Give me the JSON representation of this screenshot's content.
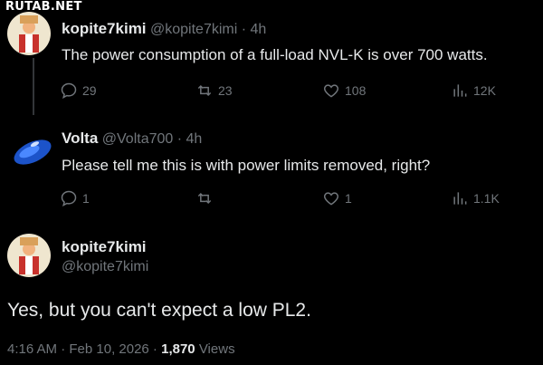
{
  "watermark": "RUTAB.NET",
  "tweets": [
    {
      "name": "kopite7kimi",
      "handle": "@kopite7kimi",
      "time": "· 4h",
      "text": "The power consumption of a full-load NVL-K is over 700 watts.",
      "replies": "29",
      "retweets": "23",
      "likes": "108",
      "views": "12K"
    },
    {
      "name": "Volta",
      "handle": "@Volta700",
      "time": "· 4h",
      "text": "Please tell me this is with power limits removed, right?",
      "replies": "1",
      "retweets": "",
      "likes": "1",
      "views": "1.1K"
    }
  ],
  "main": {
    "name": "kopite7kimi",
    "handle": "@kopite7kimi",
    "text": "Yes, but you can't expect a low PL2.",
    "timestamp": "4:16 AM · Feb 10, 2026 ·",
    "view_count": "1,870",
    "views_label": "Views"
  }
}
